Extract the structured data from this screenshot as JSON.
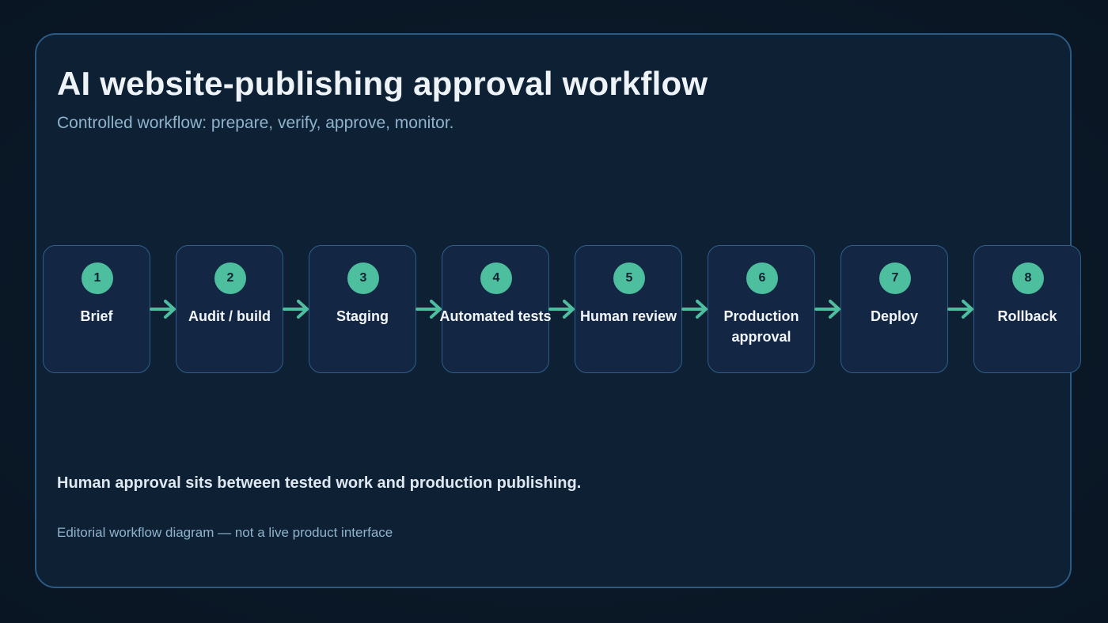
{
  "title": "AI website-publishing approval workflow",
  "subtitle": "Controlled workflow: prepare, verify, approve, monitor.",
  "steps": [
    {
      "number": "1",
      "label": "Brief"
    },
    {
      "number": "2",
      "label": "Audit / build"
    },
    {
      "number": "3",
      "label": "Staging"
    },
    {
      "number": "4",
      "label": "Automated tests"
    },
    {
      "number": "5",
      "label": "Human review"
    },
    {
      "number": "6",
      "label": "Production approval"
    },
    {
      "number": "7",
      "label": "Deploy"
    },
    {
      "number": "8",
      "label": "Rollback"
    }
  ],
  "callout": "Human approval sits between tested work and production publishing.",
  "footnote": "Editorial workflow diagram — not a live product interface",
  "colors": {
    "accent": "#4dbf9e",
    "panel_border": "#2a5a86",
    "step_fill": "#132744"
  }
}
